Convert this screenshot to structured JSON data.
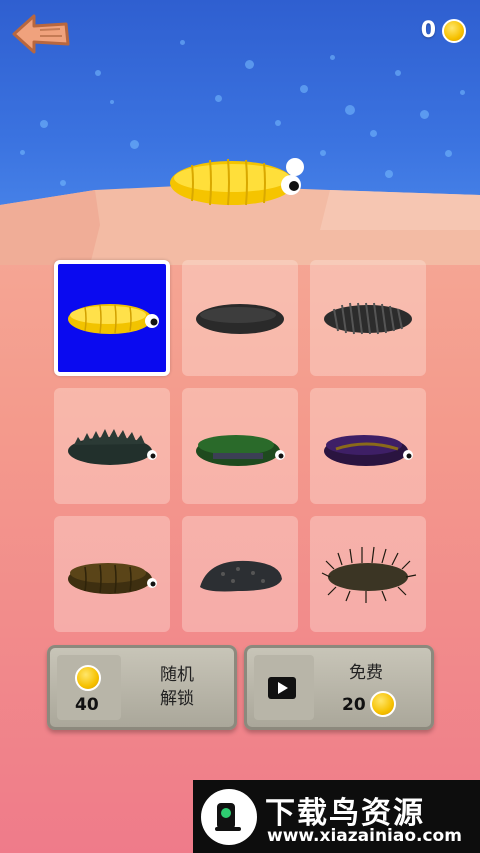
{
  "header": {
    "coin_count": "0",
    "back_icon": "back-arrow-icon",
    "coin_icon": "coin-icon"
  },
  "skins": [
    {
      "id": "yellow",
      "selected": true,
      "color": "#ffd700"
    },
    {
      "id": "dark-smooth",
      "selected": false,
      "color": "#2a2a2a"
    },
    {
      "id": "dark-segmented",
      "selected": false,
      "color": "#2a2a2a"
    },
    {
      "id": "dark-spiky",
      "selected": false,
      "color": "#22302c"
    },
    {
      "id": "green",
      "selected": false,
      "color": "#1e5a1e"
    },
    {
      "id": "purple",
      "selected": false,
      "color": "#3a1a5a"
    },
    {
      "id": "brown",
      "selected": false,
      "color": "#4a3815"
    },
    {
      "id": "dark-spotted",
      "selected": false,
      "color": "#2c2f33"
    },
    {
      "id": "hairy",
      "selected": false,
      "color": "#3b3524"
    }
  ],
  "random_unlock": {
    "price": "40",
    "label_line1": "随机",
    "label_line2": "解锁"
  },
  "free_coins": {
    "label": "免费",
    "amount": "20",
    "icon": "video-play-icon"
  },
  "watermark": {
    "title": "下载鸟资源",
    "url": "www.xiazainiao.com"
  },
  "colors": {
    "sky": "#3b73e0",
    "selected_bg": "#0a0af0",
    "coin": "#f6c100"
  }
}
